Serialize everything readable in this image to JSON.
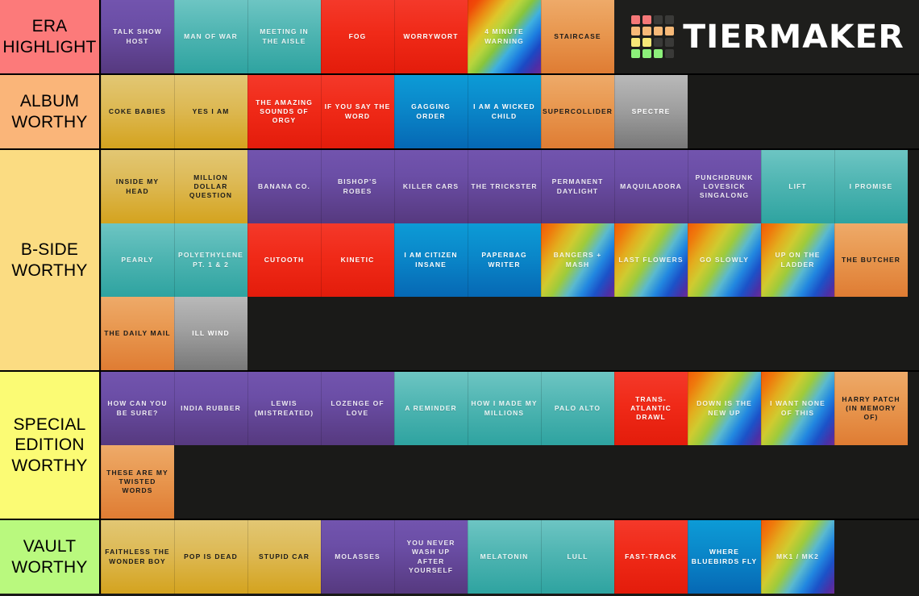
{
  "brand": {
    "name": "TIERMAKER",
    "logo_colors": [
      "#f57878",
      "#f57878",
      "#3a3a38",
      "#3a3a38",
      "#f7b978",
      "#f7b978",
      "#f7b978",
      "#f7b978",
      "#f7e878",
      "#f7e878",
      "#3a3a38",
      "#3a3a38",
      "#8cf07a",
      "#8cf07a",
      "#8cf07a",
      "#3a3a38"
    ]
  },
  "tiers": [
    {
      "label": "ERA HIGHLIGHT",
      "label_color": "#fc7a7a",
      "rows": [
        [
          {
            "title": "TALK SHOW HOST",
            "art": "art-purple",
            "text": "lighttr"
          },
          {
            "title": "MAN OF WAR",
            "art": "art-teal",
            "text": "lighttr"
          },
          {
            "title": "MEETING IN THE AISLE",
            "art": "art-teal",
            "text": "lighttr"
          },
          {
            "title": "FOG",
            "art": "art-red",
            "text": "light"
          },
          {
            "title": "WORRYWORT",
            "art": "art-red",
            "text": "light"
          },
          {
            "title": "4 MINUTE WARNING",
            "art": "art-rainbow",
            "text": "lighttr"
          },
          {
            "title": "STAIRCASE",
            "art": "art-orange",
            "text": "dark"
          }
        ]
      ]
    },
    {
      "label": "ALBUM WORTHY",
      "label_color": "#fab579",
      "rows": [
        [
          {
            "title": "COKE BABIES",
            "art": "art-gold",
            "text": "dark"
          },
          {
            "title": "YES I AM",
            "art": "art-gold",
            "text": "dark"
          },
          {
            "title": "THE AMAZING SOUNDS OF ORGY",
            "art": "art-red",
            "text": "light"
          },
          {
            "title": "IF YOU SAY THE WORD",
            "art": "art-red",
            "text": "light"
          },
          {
            "title": "GAGGING ORDER",
            "art": "art-blue",
            "text": "light"
          },
          {
            "title": "I AM A WICKED CHILD",
            "art": "art-blue",
            "text": "light"
          },
          {
            "title": "SUPERCOLLIDER",
            "art": "art-orange",
            "text": "dark"
          },
          {
            "title": "SPECTRE",
            "art": "art-grey",
            "text": "light"
          }
        ]
      ]
    },
    {
      "label": "B-SIDE WORTHY",
      "label_color": "#fbdc82",
      "rows": [
        [
          {
            "title": "INSIDE MY HEAD",
            "art": "art-gold",
            "text": "dark"
          },
          {
            "title": "MILLION DOLLAR QUESTION",
            "art": "art-gold",
            "text": "dark"
          },
          {
            "title": "BANANA CO.",
            "art": "art-purple",
            "text": "lighttr"
          },
          {
            "title": "BISHOP'S ROBES",
            "art": "art-purple",
            "text": "lighttr"
          },
          {
            "title": "KILLER CARS",
            "art": "art-purple",
            "text": "lighttr"
          },
          {
            "title": "THE TRICKSTER",
            "art": "art-purple",
            "text": "lighttr"
          },
          {
            "title": "PERMANENT DAYLIGHT",
            "art": "art-purple",
            "text": "lighttr"
          },
          {
            "title": "MAQUILADORA",
            "art": "art-purple",
            "text": "lighttr"
          },
          {
            "title": "PUNCHDRUNK LOVESICK SINGALONG",
            "art": "art-purple",
            "text": "lighttr"
          },
          {
            "title": "LIFT",
            "art": "art-teal",
            "text": "lighttr"
          },
          {
            "title": "I PROMISE",
            "art": "art-teal",
            "text": "lighttr"
          }
        ],
        [
          {
            "title": "PEARLY",
            "art": "art-teal",
            "text": "lighttr"
          },
          {
            "title": "POLYETHYLENE PT. 1 & 2",
            "art": "art-teal",
            "text": "lighttr"
          },
          {
            "title": "CUTOOTH",
            "art": "art-red",
            "text": "light"
          },
          {
            "title": "KINETIC",
            "art": "art-red",
            "text": "light"
          },
          {
            "title": "I AM CITIZEN INSANE",
            "art": "art-blue",
            "text": "light"
          },
          {
            "title": "PAPERBAG WRITER",
            "art": "art-blue",
            "text": "light"
          },
          {
            "title": "BANGERS + MASH",
            "art": "art-rainbow2",
            "text": "lighttr"
          },
          {
            "title": "LAST FLOWERS",
            "art": "art-rainbow2",
            "text": "lighttr"
          },
          {
            "title": "GO SLOWLY",
            "art": "art-rainbow2",
            "text": "lighttr"
          },
          {
            "title": "UP ON THE LADDER",
            "art": "art-rainbow2",
            "text": "lighttr"
          },
          {
            "title": "THE BUTCHER",
            "art": "art-orange",
            "text": "dark"
          }
        ],
        [
          {
            "title": "THE DAILY MAIL",
            "art": "art-orange",
            "text": "dark"
          },
          {
            "title": "ILL WIND",
            "art": "art-grey",
            "text": "light"
          }
        ]
      ]
    },
    {
      "label": "SPECIAL EDITION WORTHY",
      "label_color": "#fbfb74",
      "rows": [
        [
          {
            "title": "HOW CAN YOU BE SURE?",
            "art": "art-purple",
            "text": "lighttr"
          },
          {
            "title": "INDIA RUBBER",
            "art": "art-purple",
            "text": "lighttr"
          },
          {
            "title": "LEWIS (MISTREATED)",
            "art": "art-purple",
            "text": "lighttr"
          },
          {
            "title": "LOZENGE OF LOVE",
            "art": "art-purple",
            "text": "lighttr"
          },
          {
            "title": "A REMINDER",
            "art": "art-teal",
            "text": "lighttr"
          },
          {
            "title": "HOW I MADE MY MILLIONS",
            "art": "art-teal",
            "text": "lighttr"
          },
          {
            "title": "PALO ALTO",
            "art": "art-teal",
            "text": "lighttr"
          },
          {
            "title": "TRANS-ATLANTIC DRAWL",
            "art": "art-red",
            "text": "light"
          },
          {
            "title": "DOWN IS THE NEW UP",
            "art": "art-rainbow2",
            "text": "lighttr"
          },
          {
            "title": "I WANT NONE OF THIS",
            "art": "art-rainbow2",
            "text": "lighttr"
          },
          {
            "title": "HARRY PATCH (IN MEMORY OF)",
            "art": "art-orange",
            "text": "dark"
          }
        ],
        [
          {
            "title": "THESE ARE MY TWISTED WORDS",
            "art": "art-orange",
            "text": "dark"
          }
        ]
      ]
    },
    {
      "label": "VAULT WORTHY",
      "label_color": "#b9f97e",
      "rows": [
        [
          {
            "title": "FAITHLESS THE WONDER BOY",
            "art": "art-gold",
            "text": "dark"
          },
          {
            "title": "POP IS DEAD",
            "art": "art-gold",
            "text": "dark"
          },
          {
            "title": "STUPID CAR",
            "art": "art-gold",
            "text": "dark"
          },
          {
            "title": "MOLASSES",
            "art": "art-purple",
            "text": "lighttr"
          },
          {
            "title": "YOU NEVER WASH UP AFTER YOURSELF",
            "art": "art-purple",
            "text": "lighttr"
          },
          {
            "title": "MELATONIN",
            "art": "art-teal",
            "text": "lighttr"
          },
          {
            "title": "LULL",
            "art": "art-teal",
            "text": "lighttr"
          },
          {
            "title": "FAST-TRACK",
            "art": "art-red",
            "text": "light"
          },
          {
            "title": "WHERE BLUEBIRDS FLY",
            "art": "art-blue",
            "text": "light"
          },
          {
            "title": "MK1 / MK2",
            "art": "art-rainbow2",
            "text": "lighttr"
          }
        ]
      ]
    }
  ]
}
